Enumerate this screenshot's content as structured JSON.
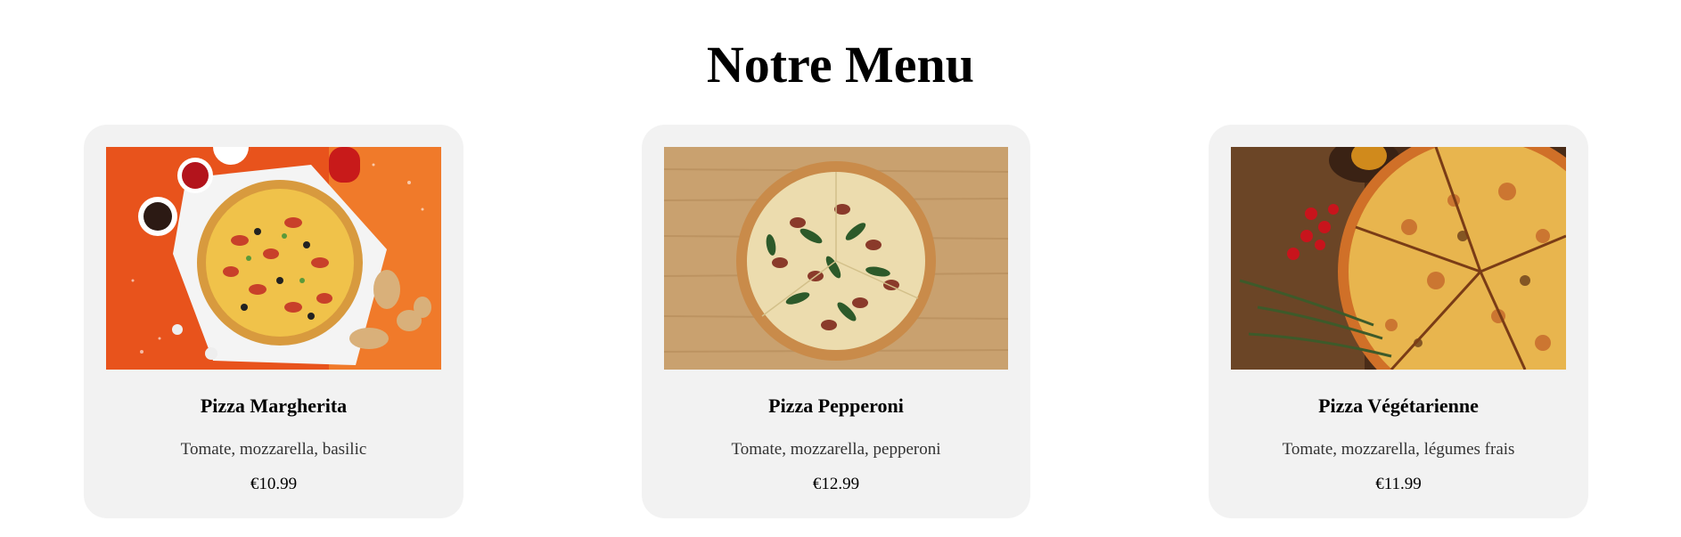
{
  "page": {
    "title": "Notre Menu"
  },
  "items": [
    {
      "name": "Pizza Margherita",
      "description": "Tomate, mozzarella, basilic",
      "price": "€10.99",
      "image": "pizza-margherita-photo"
    },
    {
      "name": "Pizza Pepperoni",
      "description": "Tomate, mozzarella, pepperoni",
      "price": "€12.99",
      "image": "pizza-pepperoni-photo"
    },
    {
      "name": "Pizza Végétarienne",
      "description": "Tomate, mozzarella, légumes frais",
      "price": "€11.99",
      "image": "pizza-vegetarienne-photo"
    }
  ],
  "colors": {
    "card_bg": "#f2f2f2",
    "page_bg": "#ffffff",
    "text": "#000000",
    "desc_text": "#333333"
  }
}
